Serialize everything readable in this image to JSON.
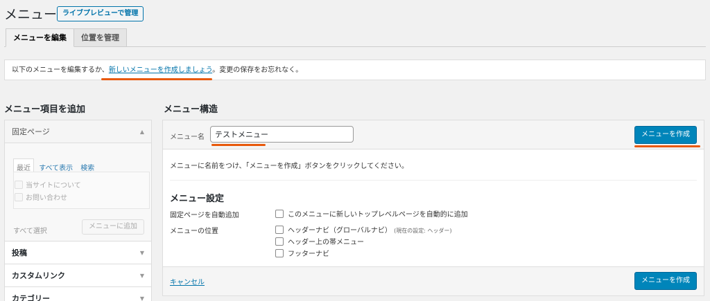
{
  "header": {
    "title": "メニュー",
    "live_preview_button": "ライブプレビューで管理"
  },
  "tabs": [
    {
      "label": "メニューを編集",
      "active": true
    },
    {
      "label": "位置を管理",
      "active": false
    }
  ],
  "notice": {
    "before": "以下のメニューを編集するか、",
    "link": "新しいメニューを作成しましょう",
    "after": "。変更の保存をお忘れなく。"
  },
  "left": {
    "heading": "メニュー項目を追加",
    "sections": [
      {
        "label": "固定ページ",
        "open": true
      },
      {
        "label": "投稿"
      },
      {
        "label": "カスタムリンク"
      },
      {
        "label": "カテゴリー"
      }
    ],
    "pages_subtabs": [
      "最近",
      "すべて表示",
      "検索"
    ],
    "pages_items": [
      "当サイトについて",
      "お問い合わせ"
    ],
    "select_all": "すべて選択",
    "add_button": "メニューに追加"
  },
  "right": {
    "heading": "メニュー構造",
    "name_label": "メニュー名",
    "name_value": "テストメニュー",
    "create_button": "メニューを作成",
    "description": "メニューに名前をつけ、「メニューを作成」ボタンをクリックしてください。",
    "settings_title": "メニュー設定",
    "auto_add_label": "固定ページを自動追加",
    "auto_add_option": "このメニューに新しいトップレベルページを自動的に追加",
    "location_label": "メニューの位置",
    "locations": [
      {
        "label": "ヘッダーナビ（グローバルナビ）",
        "note": "(現在の設定: ヘッダー)"
      },
      {
        "label": "ヘッダー上の帯メニュー",
        "note": ""
      },
      {
        "label": "フッターナビ",
        "note": ""
      }
    ],
    "cancel": "キャンセル",
    "create_button_bottom": "メニューを作成"
  },
  "colors": {
    "accent": "#0085ba",
    "link": "#0073aa",
    "annotation": "#e8590c"
  }
}
